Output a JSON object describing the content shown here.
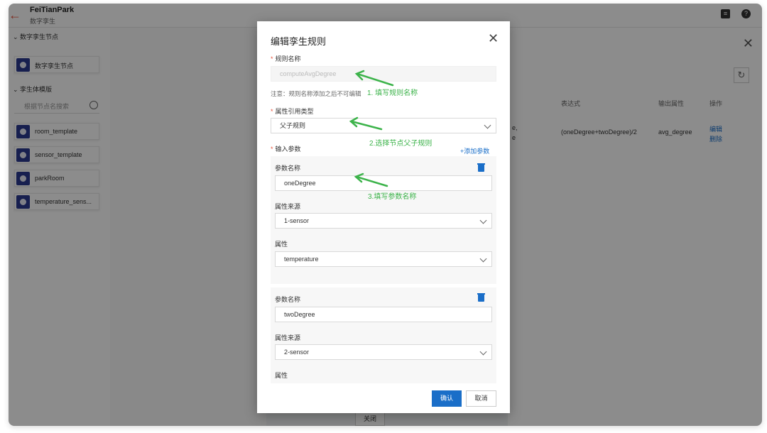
{
  "header": {
    "app_title": "FeiTianPark",
    "app_subtitle": "数字孪生",
    "back_icon": "arrow-left-icon",
    "doc_icon": "document-icon",
    "help_icon": "help-icon"
  },
  "sidebar": {
    "section1": "数字孪生节点",
    "twin_node_label": "数字孪生节点",
    "section2": "孪生体模版",
    "search_placeholder": "根据节点名搜索",
    "templates": [
      "room_template",
      "sensor_template",
      "parkRoom",
      "temperature_sens..."
    ]
  },
  "background": {
    "table_headers": {
      "expr": "表达式",
      "output": "输出属性",
      "ops": "操作"
    },
    "row": {
      "partial": "e,",
      "partial2": "e",
      "expr": "(oneDegree+twoDegree)/2",
      "output": "avg_degree",
      "edit": "编辑",
      "delete": "删除"
    },
    "close_button": "关闭"
  },
  "modal": {
    "title": "编辑孪生规则",
    "rule_name_label": "规则名称",
    "rule_name_value": "computeAvgDegree",
    "note": "注意：规则名称添加之后不可编辑",
    "ref_type_label": "属性引用类型",
    "ref_type_value": "父子规则",
    "input_params_label": "输入参数",
    "add_param": "+添加参数",
    "params": [
      {
        "name_label": "参数名称",
        "name_value": "oneDegree",
        "source_label": "属性来源",
        "source_value": "1-sensor",
        "attr_label": "属性",
        "attr_value": "temperature"
      },
      {
        "name_label": "参数名称",
        "name_value": "twoDegree",
        "source_label": "属性来源",
        "source_value": "2-sensor",
        "attr_label": "属性"
      }
    ],
    "confirm": "确认",
    "cancel": "取消"
  },
  "annotations": [
    "1. 填写规则名称",
    "2.选择节点父子规则",
    "3.填写参数名称"
  ],
  "colors": {
    "accent": "#1a6ec8",
    "required": "#e8533c",
    "annotation": "#3cb34a",
    "sidebar_icon": "#2b3990"
  }
}
